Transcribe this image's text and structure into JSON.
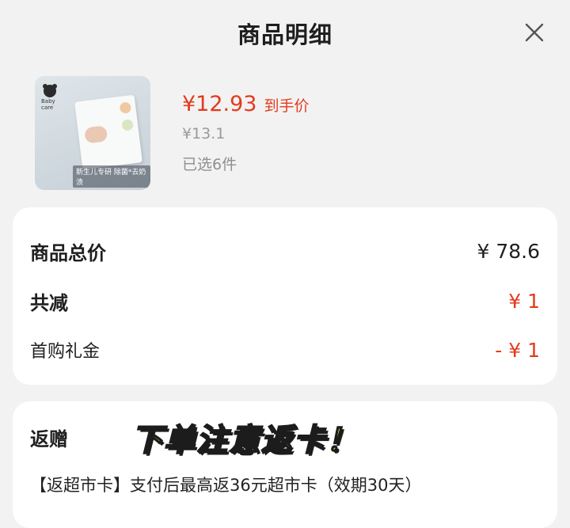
{
  "header": {
    "title": "商品明细",
    "close_icon": "close-icon"
  },
  "product": {
    "thumbnail": {
      "brand": "Baby care",
      "tag": "新生儿专研 除菌*去奶渍"
    },
    "price": "¥12.93",
    "price_tag": "到手价",
    "original_price": "¥13.1",
    "quantity_text": "已选6件"
  },
  "summary": {
    "total_label": "商品总价",
    "total_value": "¥ 78.6",
    "discount_label": "共减",
    "discount_value": "¥ 1",
    "gift_label": "首购礼金",
    "gift_value": "- ¥ 1"
  },
  "rebate": {
    "title": "返赠",
    "promo_text": "下单注意返卡！",
    "description": "【返超市卡】支付后最高返36元超市卡（效期30天）"
  },
  "colors": {
    "accent_red": "#e33a1d",
    "promo_yellow": "#ffe24a",
    "background": "#f2f2f2"
  }
}
